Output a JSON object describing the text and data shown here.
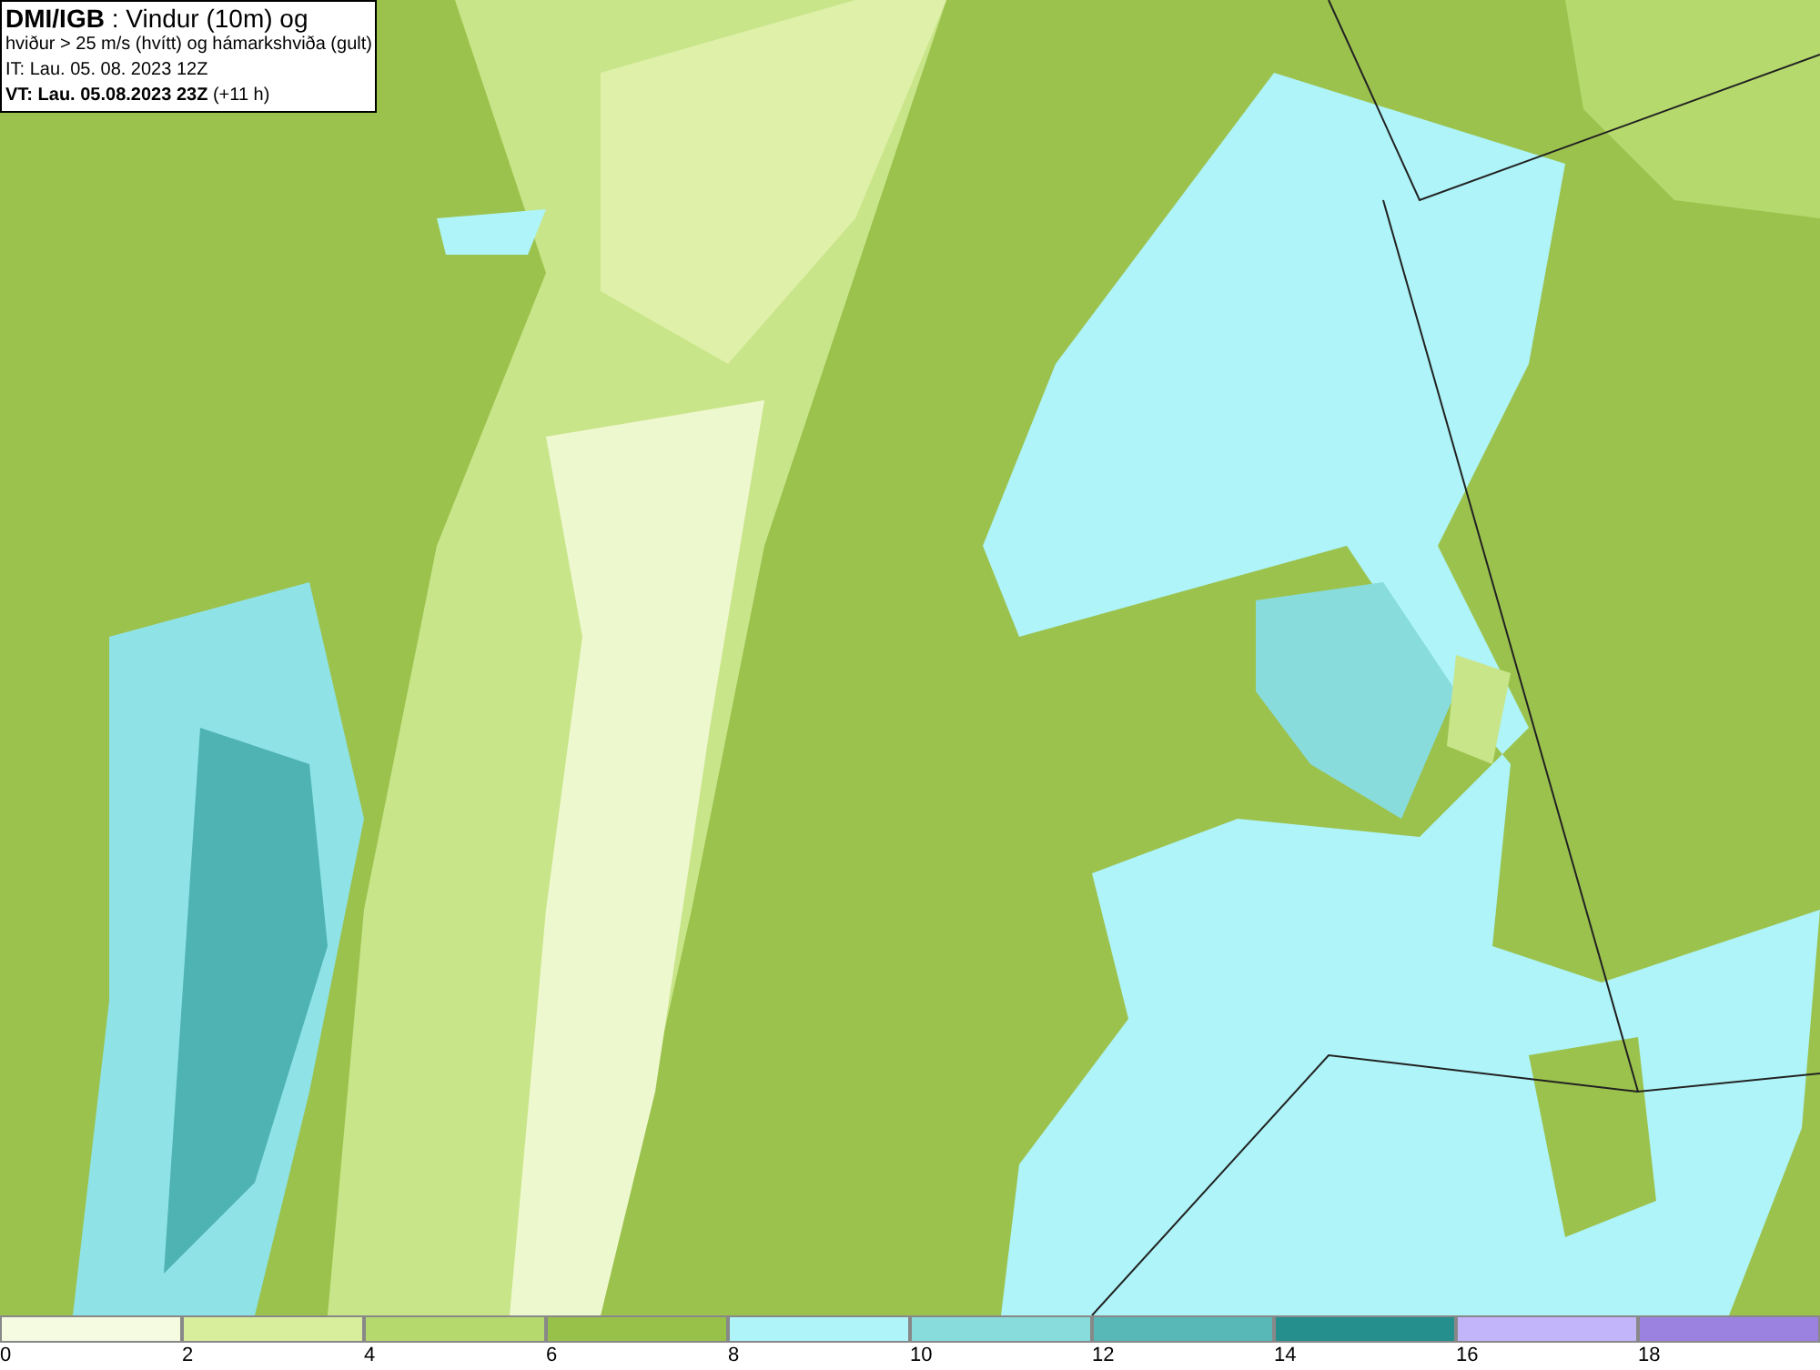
{
  "header": {
    "lines": [
      "**DMI/IGB** : Vindur (10m) og",
      "hviður > 25 m/s (hvítt) og hámarkshviða (gult)",
      "IT: Lau. 05. 08. 2023 12Z",
      "**VT: Lau. 05.08.2023 23Z** (+11 h)"
    ]
  },
  "legend": {
    "bins": [
      {
        "label": "0",
        "color": "#f5fbe0"
      },
      {
        "label": "2",
        "color": "#d8ee9c"
      },
      {
        "label": "4",
        "color": "#b5d96c"
      },
      {
        "label": "6",
        "color": "#98c14a"
      },
      {
        "label": "8",
        "color": "#aef4f8"
      },
      {
        "label": "10",
        "color": "#88dcdc"
      },
      {
        "label": "12",
        "color": "#58b8b8"
      },
      {
        "label": "14",
        "color": "#248f8c"
      },
      {
        "label": "16",
        "color": "#c3b5fa"
      },
      {
        "label": "18",
        "color": "#9c82e0"
      }
    ]
  }
}
